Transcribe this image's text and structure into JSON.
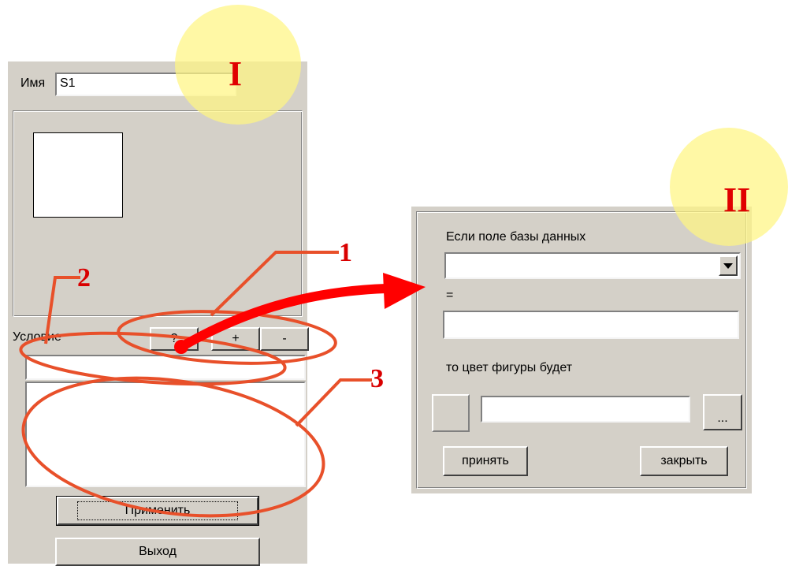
{
  "window1": {
    "name_label": "Имя",
    "name_value": "S1",
    "condition_label": "Условие",
    "buttons": {
      "query": "?",
      "add": "+",
      "remove": "-"
    },
    "apply_label": "Применить",
    "exit_label": "Выход"
  },
  "window2": {
    "field_label": "Если поле базы данных",
    "equals_label": "=",
    "color_label": "то цвет фигуры будет",
    "browse_label": "...",
    "accept_label": "принять",
    "close_label": "закрыть"
  },
  "callouts": {
    "window1_marker": "I",
    "window2_marker": "II",
    "c1": "1",
    "c2": "2",
    "c3": "3"
  },
  "colors": {
    "dialog_bg": "#d4d0c8",
    "annotation": "#e8502a",
    "arrow": "#ff0000",
    "marker_text": "#e00000",
    "marker_highlight": "#fff582"
  },
  "icons": {
    "dropdown": "chevron-down-icon"
  }
}
